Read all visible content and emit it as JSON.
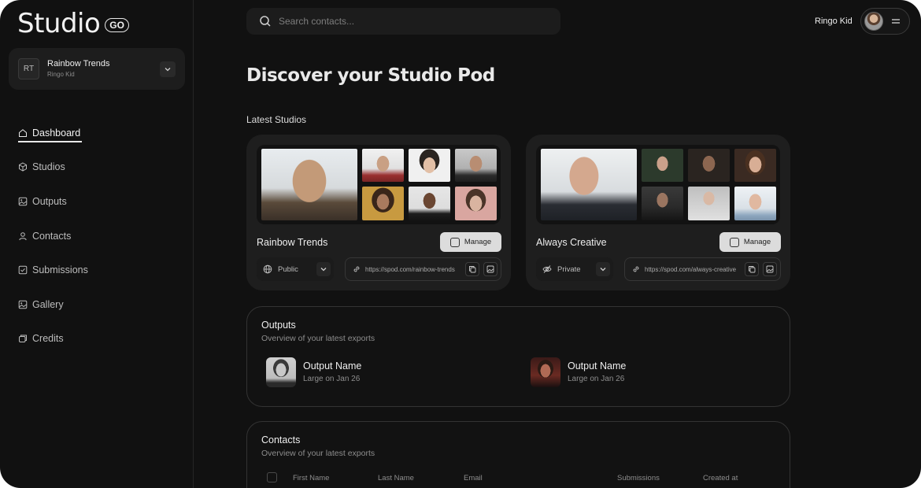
{
  "brand": {
    "name": "Studio",
    "badge": "GO"
  },
  "workspace": {
    "initials": "RT",
    "name": "Rainbow Trends",
    "owner": "Ringo Kid"
  },
  "nav": [
    {
      "label": "Dashboard",
      "icon": "home-icon",
      "active": true
    },
    {
      "label": "Studios",
      "icon": "cube-icon"
    },
    {
      "label": "Outputs",
      "icon": "image-icon"
    },
    {
      "label": "Contacts",
      "icon": "user-icon"
    },
    {
      "label": "Submissions",
      "icon": "check-square-icon"
    },
    {
      "label": "Gallery",
      "icon": "gallery-icon"
    },
    {
      "label": "Credits",
      "icon": "credits-icon"
    }
  ],
  "search": {
    "placeholder": "Search contacts..."
  },
  "user": {
    "name": "Ringo Kid"
  },
  "page": {
    "title": "Discover your Studio Pod",
    "latest_label": "Latest Studios"
  },
  "studios": [
    {
      "name": "Rainbow Trends",
      "manage_label": "Manage",
      "visibility": "Public",
      "visibility_icon": "globe-icon",
      "url": "https://spod.com/rainbow-trends"
    },
    {
      "name": "Always Creative",
      "manage_label": "Manage",
      "visibility": "Private",
      "visibility_icon": "eye-off-icon",
      "url": "https://spod.com/always-creative"
    }
  ],
  "outputs": {
    "title": "Outputs",
    "subtitle": "Overview of your latest exports",
    "items": [
      {
        "name": "Output Name",
        "meta": "Large on Jan 26"
      },
      {
        "name": "Output Name",
        "meta": "Large on Jan 26"
      }
    ]
  },
  "contacts": {
    "title": "Contacts",
    "subtitle": "Overview of your latest exports",
    "columns": [
      "First Name",
      "Last Name",
      "Email",
      "Submissions",
      "Created at"
    ]
  },
  "colors": {
    "background": "#111111",
    "card": "#1e1e1e",
    "accent": "#dcdcdc"
  }
}
